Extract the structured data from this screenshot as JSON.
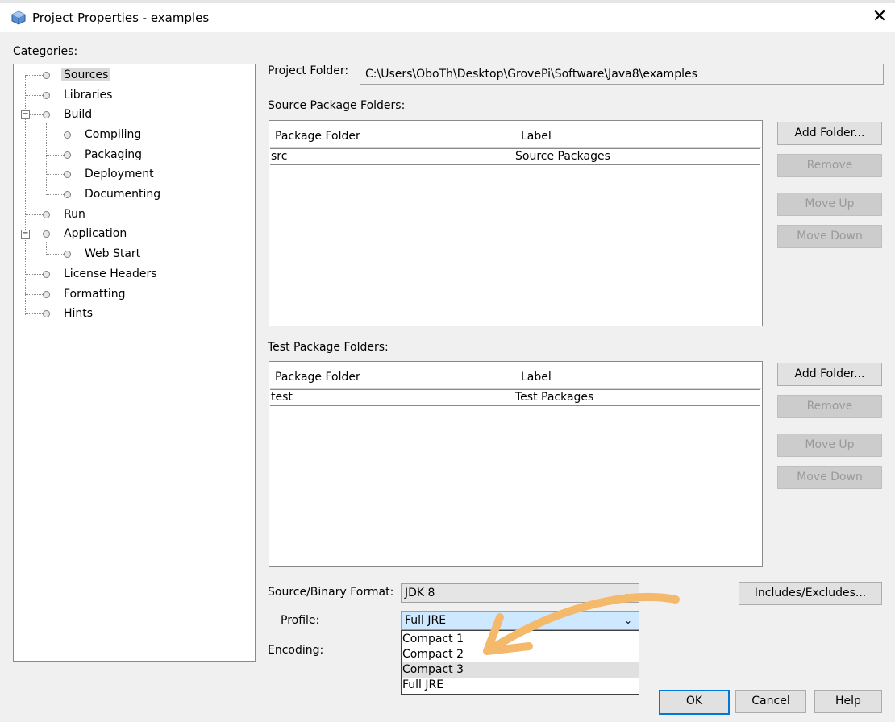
{
  "window": {
    "title": "Project Properties - examples",
    "close_glyph": "✕"
  },
  "categories": {
    "label": "Categories:",
    "items": [
      {
        "label": "Sources",
        "selected": true
      },
      {
        "label": "Libraries"
      },
      {
        "label": "Build",
        "expanded": true
      },
      {
        "label": "Compiling"
      },
      {
        "label": "Packaging"
      },
      {
        "label": "Deployment"
      },
      {
        "label": "Documenting"
      },
      {
        "label": "Run"
      },
      {
        "label": "Application",
        "expanded": true
      },
      {
        "label": "Web Start"
      },
      {
        "label": "License Headers"
      },
      {
        "label": "Formatting"
      },
      {
        "label": "Hints"
      }
    ]
  },
  "project_folder": {
    "label": "Project Folder:",
    "value": "C:\\Users\\OboTh\\Desktop\\GrovePi\\Software\\Java8\\examples"
  },
  "source_packages": {
    "label": "Source Package Folders:",
    "columns": [
      "Package Folder",
      "Label"
    ],
    "rows": [
      [
        "src",
        "Source Packages"
      ]
    ]
  },
  "test_packages": {
    "label": "Test Package Folders:",
    "columns": [
      "Package Folder",
      "Label"
    ],
    "rows": [
      [
        "test",
        "Test Packages"
      ]
    ]
  },
  "buttons": {
    "add_folder": "Add Folder...",
    "remove": "Remove",
    "move_up": "Move Up",
    "move_down": "Move Down",
    "includes_excludes": "Includes/Excludes...",
    "ok": "OK",
    "cancel": "Cancel",
    "help": "Help"
  },
  "format": {
    "source_binary_label": "Source/Binary Format:",
    "source_binary_value": "JDK 8",
    "profile_label": "Profile:",
    "profile_value": "Full JRE",
    "encoding_label": "Encoding:",
    "profile_options": [
      "Compact 1",
      "Compact 2",
      "Compact 3",
      "Full JRE"
    ],
    "chevron": "⌄"
  },
  "annotation": {
    "arrow_color": "#f5b96b"
  },
  "colors": {
    "focus_blue": "#0078d7",
    "selection_bg": "#cde8ff"
  }
}
